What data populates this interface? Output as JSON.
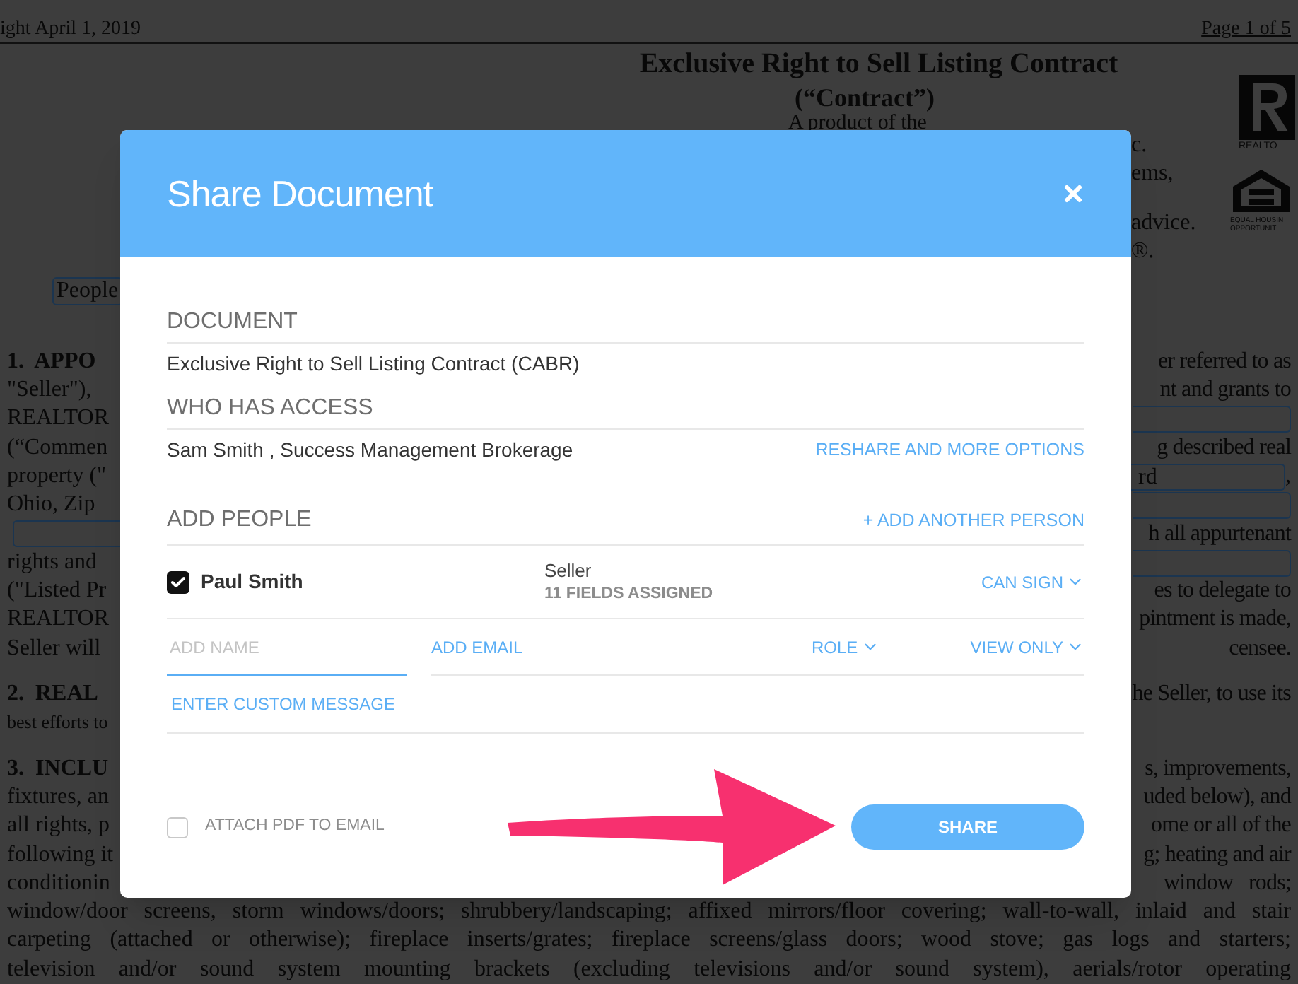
{
  "document": {
    "header_left": "ight April 1, 2019",
    "header_right": "Page 1 of 5",
    "title": "Exclusive Right to Sell Listing Contract",
    "subtitle": "(“Contract”)",
    "byline": "A product of the",
    "right_fragments": [
      "c.",
      "ems,",
      "advice.",
      "®."
    ],
    "realtor_caption": "REALTO",
    "housing_caption": [
      "EQUAL HOUSIN",
      "OPPORTUNIT"
    ],
    "tag": "People",
    "paragraphs": [
      {
        "lines": [
          {
            "left": {
              "kind": "heading",
              "text": "1.  APPO"
            },
            "right": {
              "kind": "text",
              "text": "er referred to as"
            }
          },
          {
            "left": {
              "kind": "text",
              "text": "\"Seller\"),"
            },
            "right": {
              "kind": "text",
              "text": "nt and grants to"
            }
          },
          {
            "left": {
              "kind": "text",
              "text": "REALTOR"
            },
            "right": {
              "kind": "field"
            }
          },
          {
            "left": {
              "kind": "text",
              "text": "(“Commen"
            },
            "right": {
              "kind": "text",
              "text": "g described real"
            }
          },
          {
            "left": {
              "kind": "text",
              "text": "property (\""
            },
            "right": {
              "kind": "field",
              "text": "rd",
              "suffix": ","
            }
          },
          {
            "left": {
              "kind": "text",
              "text": "Ohio, Zip"
            },
            "right": {
              "kind": "field"
            }
          },
          {
            "left": {
              "kind": "field"
            },
            "right": {
              "kind": "text",
              "text": "h all appurtenant"
            }
          },
          {
            "left": {
              "kind": "text",
              "text": "rights and"
            },
            "right": {
              "kind": "field"
            }
          },
          {
            "left": {
              "kind": "text",
              "text": "(\"Listed Pr"
            },
            "right": {
              "kind": "text",
              "text": "es to delegate to"
            }
          },
          {
            "left": {
              "kind": "text",
              "text": "REALTOR"
            },
            "right": {
              "kind": "text",
              "text": "pintment is made,"
            }
          },
          {
            "left": {
              "kind": "text",
              "text": "Seller will"
            },
            "right": {
              "kind": "text",
              "text": "censee."
            }
          }
        ]
      },
      {
        "lines": [
          {
            "left": {
              "kind": "heading",
              "text": "2.  REAL"
            },
            "right": {
              "kind": "text",
              "text": "he Seller, to use its"
            }
          },
          {
            "left": {
              "kind": "small",
              "text": "best efforts to"
            }
          }
        ]
      },
      {
        "lines": [
          {
            "left": {
              "kind": "heading",
              "text": "3.  INCLU"
            },
            "right": {
              "kind": "text",
              "text": "s, improvements,"
            }
          },
          {
            "left": {
              "kind": "text",
              "text": "fixtures, an"
            },
            "right": {
              "kind": "text",
              "text": "uded below), and"
            }
          },
          {
            "left": {
              "kind": "text",
              "text": "all rights, p"
            },
            "right": {
              "kind": "text",
              "text": "ome or all of the"
            }
          },
          {
            "left": {
              "kind": "text",
              "text": "following it"
            },
            "right": {
              "kind": "text",
              "text": "g; heating and air"
            }
          },
          {
            "left": {
              "kind": "text",
              "text": "conditionin"
            },
            "right": {
              "kind": "text",
              "text": "window   rods;"
            }
          },
          {
            "left": {
              "kind": "full",
              "text": "window/door screens, storm windows/doors; shrubbery/landscaping; affixed mirrors/floor covering; wall-to-wall, inlaid and stair"
            }
          },
          {
            "left": {
              "kind": "full",
              "text": "carpeting (attached or otherwise); fireplace inserts/grates; fireplace screens/glass doors; wood stove; gas logs and starters;"
            }
          },
          {
            "left": {
              "kind": "full",
              "text": "television and/or sound system mounting brackets (excluding televisions and/or sound system), aerials/rotor operating"
            }
          }
        ]
      }
    ]
  },
  "dialog": {
    "title": "Share Document",
    "sections": [
      {
        "heading": "DOCUMENT",
        "value": "Exclusive Right to Sell Listing Contract (CABR)"
      },
      {
        "heading": "WHO HAS ACCESS",
        "value": "Sam Smith , Success Management Brokerage",
        "action": "RESHARE AND MORE OPTIONS"
      }
    ],
    "add_people": {
      "heading": "ADD PEOPLE",
      "action": "+ ADD ANOTHER PERSON",
      "people": [
        {
          "name": "Paul Smith",
          "checked": true,
          "role": "Seller",
          "fields": "11 FIELDS ASSIGNED",
          "permission": "CAN SIGN"
        }
      ],
      "new_person": {
        "name_field": {
          "placeholder": "ADD NAME"
        },
        "email_field": {
          "placeholder": "ADD EMAIL"
        },
        "role": "ROLE",
        "permission": "VIEW ONLY",
        "message_link": "ENTER CUSTOM MESSAGE"
      }
    },
    "attach_pdf": {
      "label": "ATTACH PDF TO EMAIL",
      "checked": false
    },
    "share_button": "SHARE"
  }
}
